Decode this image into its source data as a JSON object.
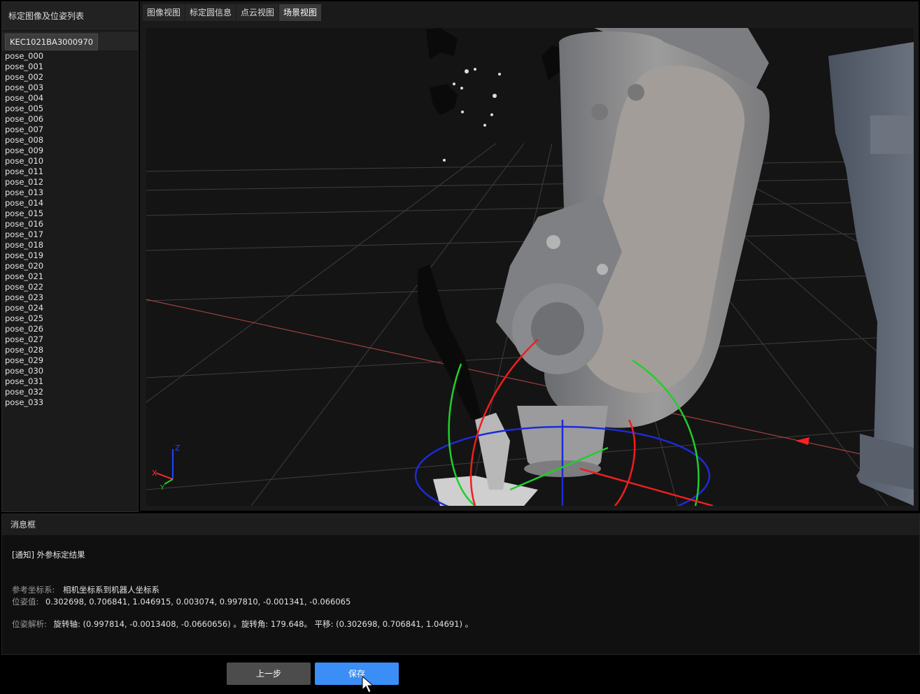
{
  "left_panel": {
    "title": "标定图像及位姿列表",
    "device_id": "KEC1021BA3000970",
    "poses": [
      "pose_000",
      "pose_001",
      "pose_002",
      "pose_003",
      "pose_004",
      "pose_005",
      "pose_006",
      "pose_007",
      "pose_008",
      "pose_009",
      "pose_010",
      "pose_011",
      "pose_012",
      "pose_013",
      "pose_014",
      "pose_015",
      "pose_016",
      "pose_017",
      "pose_018",
      "pose_019",
      "pose_020",
      "pose_021",
      "pose_022",
      "pose_023",
      "pose_024",
      "pose_025",
      "pose_026",
      "pose_027",
      "pose_028",
      "pose_029",
      "pose_030",
      "pose_031",
      "pose_032",
      "pose_033"
    ]
  },
  "tabs": [
    {
      "label": "图像视图",
      "active": false
    },
    {
      "label": "标定圆信息",
      "active": false
    },
    {
      "label": "点云视图",
      "active": false
    },
    {
      "label": "场景视图",
      "active": true
    }
  ],
  "viewport": {
    "axis_labels": {
      "x": "X",
      "y": "Y",
      "z": "Z"
    },
    "colors": {
      "x": "#ff2a2a",
      "y": "#22cc22",
      "z": "#2244ff",
      "robot": "#8e8e90",
      "grid": "#4a4a4a"
    }
  },
  "message_box": {
    "title": "消息框",
    "notice": "[通知] 外参标定结果",
    "ref_label": "参考坐标系:",
    "ref_value": "相机坐标系到机器人坐标系",
    "pose_label": "位姿值:",
    "pose_value": "0.302698, 0.706841, 1.046915, 0.003074, 0.997810, -0.001341, -0.066065",
    "analysis_label": "位姿解析:",
    "analysis_value": "旋转轴: (0.997814, -0.0013408, -0.0660656) 。旋转角: 179.648。 平移: (0.302698, 0.706841, 1.04691) 。"
  },
  "buttons": {
    "prev": "上一步",
    "save": "保存"
  }
}
